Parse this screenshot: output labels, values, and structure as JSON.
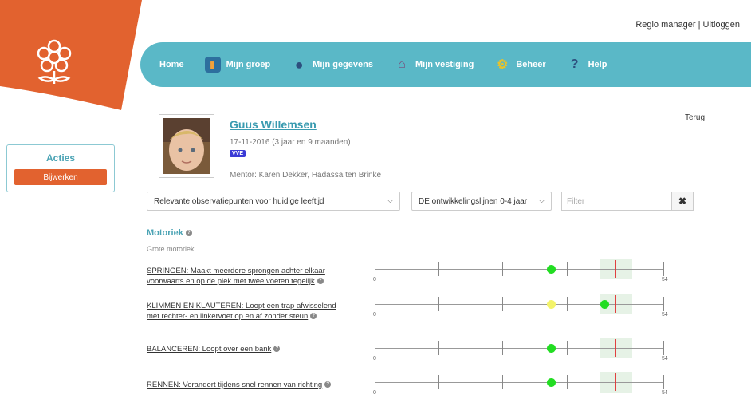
{
  "header": {
    "user_role": "Regio manager",
    "separator": "|",
    "logout": "Uitloggen"
  },
  "brand": {
    "accent": "#e2622f",
    "nav_bg": "#5ab8c7"
  },
  "nav": {
    "items": [
      {
        "label": "Home",
        "icon": ""
      },
      {
        "label": "Mijn groep",
        "icon": "book-icon"
      },
      {
        "label": "Mijn gegevens",
        "icon": "person-icon"
      },
      {
        "label": "Mijn vestiging",
        "icon": "house-icon"
      },
      {
        "label": "Beheer",
        "icon": "gears-icon"
      },
      {
        "label": "Help",
        "icon": "help-icon"
      }
    ]
  },
  "sidebar": {
    "title": "Acties",
    "button": "Bijwerken"
  },
  "profile": {
    "name": "Guus Willemsen",
    "dob": "17-11-2016 (3 jaar en 9 maanden)",
    "badge": "VVE",
    "mentor": "Mentor: Karen Dekker, Hadassa ten Brinke",
    "back": "Terug"
  },
  "filters": {
    "select1": "Relevante observatiepunten voor huidige leeftijd",
    "select2": "DE ontwikkelingslijnen 0-4 jaar",
    "filter_placeholder": "Filter",
    "clear": "✖"
  },
  "section": {
    "title": "Motoriek",
    "subtitle": "Grote motoriek",
    "scale_min": "0",
    "scale_max": "54",
    "items": [
      {
        "label": "SPRINGEN: Maakt meerdere sprongen achter elkaar voorwaarts en op de plek met twee voeten tegelijk",
        "dots": [
          {
            "value": 33,
            "color": "#22dd22"
          }
        ]
      },
      {
        "label": "KLIMMEN EN KLAUTEREN: Loopt een trap afwisselend met rechter- en linkervoet op en af zonder steun",
        "dots": [
          {
            "value": 33,
            "color": "#f3f36a"
          },
          {
            "value": 43,
            "color": "#22dd22"
          }
        ]
      },
      {
        "label": "BALANCEREN: Loopt over een bank",
        "dots": [
          {
            "value": 33,
            "color": "#22dd22"
          }
        ]
      },
      {
        "label": "RENNEN: Verandert tijdens snel rennen van richting",
        "dots": [
          {
            "value": 33,
            "color": "#22dd22"
          }
        ]
      }
    ]
  }
}
